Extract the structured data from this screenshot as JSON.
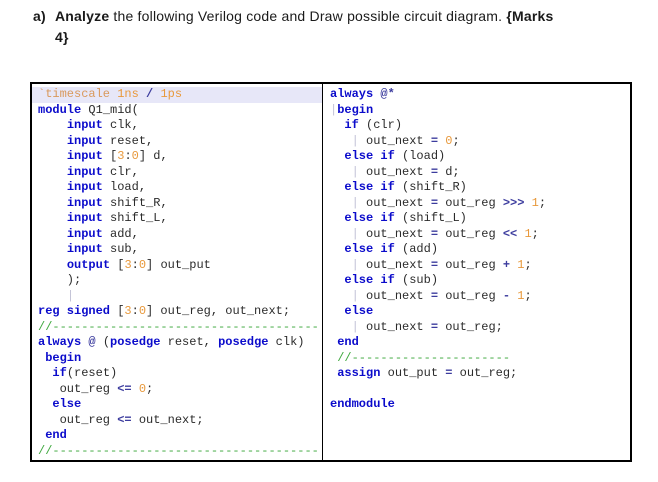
{
  "header": {
    "label": "a)",
    "bold_lead": "Analyze",
    "body": " the following Verilog code and Draw possible circuit diagram. ",
    "marks_open": "{Marks",
    "marks_close": "4}"
  },
  "colors": {
    "keyword_blue": "#0b0bcb",
    "operator_navy": "#3c3c9e",
    "number_orange": "#e8993c",
    "directive_tan": "#d9995c",
    "comment_green": "#3fa83f",
    "highlight_lavender": "#e7e7f8",
    "border_black": "#000000"
  },
  "code": {
    "left": {
      "lines": [
        {
          "hl": true,
          "s": [
            [
              "dir",
              "`timescale "
            ],
            [
              "num",
              "1ns"
            ],
            [
              "id",
              " "
            ],
            [
              "op",
              "/"
            ],
            [
              "id",
              " "
            ],
            [
              "num",
              "1ps"
            ]
          ]
        },
        {
          "s": [
            [
              "kw",
              "module"
            ],
            [
              "id",
              " Q1_mid("
            ]
          ]
        },
        {
          "s": [
            [
              "id",
              "    "
            ],
            [
              "kw",
              "input"
            ],
            [
              "id",
              " clk,"
            ]
          ]
        },
        {
          "s": [
            [
              "id",
              "    "
            ],
            [
              "kw",
              "input"
            ],
            [
              "id",
              " reset,"
            ]
          ]
        },
        {
          "s": [
            [
              "id",
              "    "
            ],
            [
              "kw",
              "input"
            ],
            [
              "id",
              " ["
            ],
            [
              "num",
              "3"
            ],
            [
              "id",
              ":"
            ],
            [
              "num",
              "0"
            ],
            [
              "id",
              "] d,"
            ]
          ]
        },
        {
          "s": [
            [
              "id",
              "    "
            ],
            [
              "kw",
              "input"
            ],
            [
              "id",
              " clr,"
            ]
          ]
        },
        {
          "s": [
            [
              "id",
              "    "
            ],
            [
              "kw",
              "input"
            ],
            [
              "id",
              " load,"
            ]
          ]
        },
        {
          "s": [
            [
              "id",
              "    "
            ],
            [
              "kw",
              "input"
            ],
            [
              "id",
              " shift_R,"
            ]
          ]
        },
        {
          "s": [
            [
              "id",
              "    "
            ],
            [
              "kw",
              "input"
            ],
            [
              "id",
              " shift_L,"
            ]
          ]
        },
        {
          "s": [
            [
              "id",
              "    "
            ],
            [
              "kw",
              "input"
            ],
            [
              "id",
              " add,"
            ]
          ]
        },
        {
          "s": [
            [
              "id",
              "    "
            ],
            [
              "kw",
              "input"
            ],
            [
              "id",
              " sub,"
            ]
          ]
        },
        {
          "s": [
            [
              "id",
              "    "
            ],
            [
              "kw",
              "output"
            ],
            [
              "id",
              " ["
            ],
            [
              "num",
              "3"
            ],
            [
              "id",
              ":"
            ],
            [
              "num",
              "0"
            ],
            [
              "id",
              "] out_put"
            ]
          ]
        },
        {
          "s": [
            [
              "id",
              "    );"
            ]
          ]
        },
        {
          "s": [
            [
              "id",
              "    "
            ],
            [
              "guide",
              "|"
            ]
          ]
        },
        {
          "s": [
            [
              "kw",
              "reg signed"
            ],
            [
              "id",
              " ["
            ],
            [
              "num",
              "3"
            ],
            [
              "id",
              ":"
            ],
            [
              "num",
              "0"
            ],
            [
              "id",
              "] out_reg, out_next;"
            ]
          ]
        },
        {
          "s": [
            [
              "cmt",
              "//-------------------------------------"
            ]
          ]
        },
        {
          "s": [
            [
              "kw",
              "always"
            ],
            [
              "id",
              " "
            ],
            [
              "op",
              "@"
            ],
            [
              "id",
              " ("
            ],
            [
              "kw",
              "posedge"
            ],
            [
              "id",
              " reset, "
            ],
            [
              "kw",
              "posedge"
            ],
            [
              "id",
              " clk)"
            ]
          ]
        },
        {
          "s": [
            [
              "id",
              " "
            ],
            [
              "kw",
              "begin"
            ]
          ]
        },
        {
          "s": [
            [
              "id",
              "  "
            ],
            [
              "kw",
              "if"
            ],
            [
              "id",
              "(reset)"
            ]
          ]
        },
        {
          "s": [
            [
              "id",
              "   out_reg "
            ],
            [
              "op",
              "<="
            ],
            [
              "id",
              " "
            ],
            [
              "num",
              "0"
            ],
            [
              "id",
              ";"
            ]
          ]
        },
        {
          "s": [
            [
              "id",
              "  "
            ],
            [
              "kw",
              "else"
            ]
          ]
        },
        {
          "s": [
            [
              "id",
              "   out_reg "
            ],
            [
              "op",
              "<="
            ],
            [
              "id",
              " out_next;"
            ]
          ]
        },
        {
          "s": [
            [
              "id",
              " "
            ],
            [
              "kw",
              "end"
            ]
          ]
        },
        {
          "s": [
            [
              "cmt",
              "//-------------------------------------"
            ]
          ]
        }
      ]
    },
    "right": {
      "lines": [
        {
          "s": [
            [
              "kw",
              "always"
            ],
            [
              "id",
              " "
            ],
            [
              "op",
              "@*"
            ]
          ]
        },
        {
          "s": [
            [
              "guide",
              "|"
            ],
            [
              "kw",
              "begin"
            ]
          ]
        },
        {
          "s": [
            [
              "id",
              "  "
            ],
            [
              "kw",
              "if"
            ],
            [
              "id",
              " (clr)"
            ]
          ]
        },
        {
          "s": [
            [
              "id",
              "   "
            ],
            [
              "guide",
              "|"
            ],
            [
              "id",
              " out_next "
            ],
            [
              "op",
              "="
            ],
            [
              "id",
              " "
            ],
            [
              "num",
              "0"
            ],
            [
              "id",
              ";"
            ]
          ]
        },
        {
          "s": [
            [
              "id",
              "  "
            ],
            [
              "kw",
              "else if"
            ],
            [
              "id",
              " (load)"
            ]
          ]
        },
        {
          "s": [
            [
              "id",
              "   "
            ],
            [
              "guide",
              "|"
            ],
            [
              "id",
              " out_next "
            ],
            [
              "op",
              "="
            ],
            [
              "id",
              " d;"
            ]
          ]
        },
        {
          "s": [
            [
              "id",
              "  "
            ],
            [
              "kw",
              "else if"
            ],
            [
              "id",
              " (shift_R)"
            ]
          ]
        },
        {
          "s": [
            [
              "id",
              "   "
            ],
            [
              "guide",
              "|"
            ],
            [
              "id",
              " out_next "
            ],
            [
              "op",
              "="
            ],
            [
              "id",
              " out_reg "
            ],
            [
              "op",
              ">>>"
            ],
            [
              "id",
              " "
            ],
            [
              "num",
              "1"
            ],
            [
              "id",
              ";"
            ]
          ]
        },
        {
          "s": [
            [
              "id",
              "  "
            ],
            [
              "kw",
              "else if"
            ],
            [
              "id",
              " (shift_L)"
            ]
          ]
        },
        {
          "s": [
            [
              "id",
              "   "
            ],
            [
              "guide",
              "|"
            ],
            [
              "id",
              " out_next "
            ],
            [
              "op",
              "="
            ],
            [
              "id",
              " out_reg "
            ],
            [
              "op",
              "<<"
            ],
            [
              "id",
              " "
            ],
            [
              "num",
              "1"
            ],
            [
              "id",
              ";"
            ]
          ]
        },
        {
          "s": [
            [
              "id",
              "  "
            ],
            [
              "kw",
              "else if"
            ],
            [
              "id",
              " (add)"
            ]
          ]
        },
        {
          "s": [
            [
              "id",
              "   "
            ],
            [
              "guide",
              "|"
            ],
            [
              "id",
              " out_next "
            ],
            [
              "op",
              "="
            ],
            [
              "id",
              " out_reg "
            ],
            [
              "op",
              "+"
            ],
            [
              "id",
              " "
            ],
            [
              "num",
              "1"
            ],
            [
              "id",
              ";"
            ]
          ]
        },
        {
          "s": [
            [
              "id",
              "  "
            ],
            [
              "kw",
              "else if"
            ],
            [
              "id",
              " (sub)"
            ]
          ]
        },
        {
          "s": [
            [
              "id",
              "   "
            ],
            [
              "guide",
              "|"
            ],
            [
              "id",
              " out_next "
            ],
            [
              "op",
              "="
            ],
            [
              "id",
              " out_reg "
            ],
            [
              "op",
              "-"
            ],
            [
              "id",
              " "
            ],
            [
              "num",
              "1"
            ],
            [
              "id",
              ";"
            ]
          ]
        },
        {
          "s": [
            [
              "id",
              "  "
            ],
            [
              "kw",
              "else"
            ]
          ]
        },
        {
          "s": [
            [
              "id",
              "   "
            ],
            [
              "guide",
              "|"
            ],
            [
              "id",
              " out_next "
            ],
            [
              "op",
              "="
            ],
            [
              "id",
              " out_reg;"
            ]
          ]
        },
        {
          "s": [
            [
              "id",
              " "
            ],
            [
              "kw",
              "end"
            ]
          ]
        },
        {
          "s": [
            [
              "id",
              " "
            ],
            [
              "cmt",
              "//----------------------"
            ]
          ]
        },
        {
          "s": [
            [
              "id",
              " "
            ],
            [
              "kw",
              "assign"
            ],
            [
              "id",
              " out_put "
            ],
            [
              "op",
              "="
            ],
            [
              "id",
              " out_reg;"
            ]
          ]
        },
        {
          "s": []
        },
        {
          "s": [
            [
              "kw",
              "endmodule"
            ]
          ]
        }
      ]
    }
  }
}
